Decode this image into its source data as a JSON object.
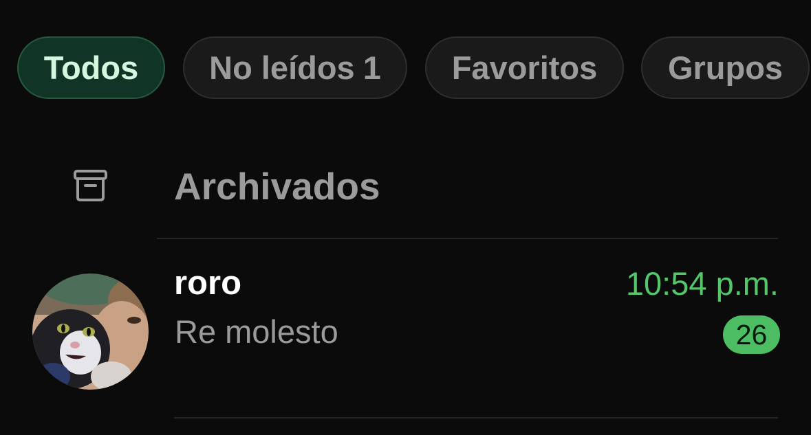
{
  "filters": {
    "items": [
      {
        "label": "Todos",
        "active": true
      },
      {
        "label": "No leídos",
        "count": "1",
        "active": false
      },
      {
        "label": "Favoritos",
        "active": false
      },
      {
        "label": "Grupos",
        "active": false
      }
    ]
  },
  "archived": {
    "label": "Archivados",
    "icon": "archive-box-icon"
  },
  "chats": [
    {
      "name": "roro",
      "preview": "Re molesto",
      "time": "10:54 p.m.",
      "unread_count": "26",
      "avatar": "profile-photo"
    }
  ],
  "colors": {
    "background": "#0b0b0b",
    "accent_green": "#53c76a",
    "badge_green": "#4cbd62",
    "active_chip_bg": "#103526",
    "active_chip_text": "#d6f7df",
    "muted_text": "#9b9b9b"
  }
}
